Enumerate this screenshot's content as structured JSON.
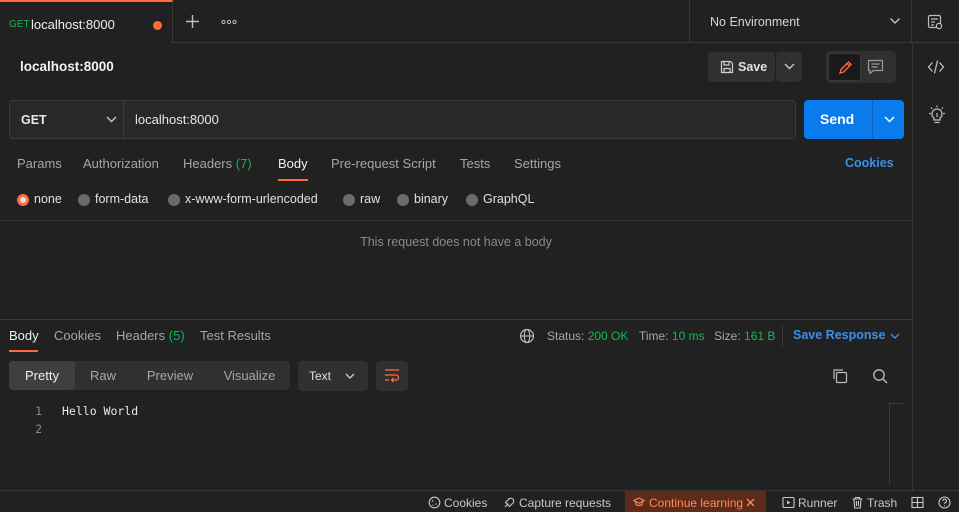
{
  "tab": {
    "method": "GET",
    "title": "localhost:8000"
  },
  "environment": {
    "label": "No Environment"
  },
  "request": {
    "name": "localhost:8000",
    "save_label": "Save",
    "method": "GET",
    "url": "localhost:8000",
    "send_label": "Send",
    "tabs": {
      "params": "Params",
      "authorization": "Authorization",
      "headers": "Headers",
      "headers_count": "(7)",
      "body": "Body",
      "prerequest": "Pre-request Script",
      "tests": "Tests",
      "settings": "Settings"
    },
    "cookies_link": "Cookies",
    "body_types": {
      "none": "none",
      "form_data": "form-data",
      "urlencoded": "x-www-form-urlencoded",
      "raw": "raw",
      "binary": "binary",
      "graphql": "GraphQL"
    },
    "selected_body_type": "none",
    "empty_body_message": "This request does not have a body"
  },
  "response": {
    "tabs": {
      "body": "Body",
      "cookies": "Cookies",
      "headers": "Headers",
      "headers_count": "(5)",
      "test_results": "Test Results"
    },
    "status_label": "Status:",
    "status_value": "200 OK",
    "time_label": "Time:",
    "time_value": "10 ms",
    "size_label": "Size:",
    "size_value": "161 B",
    "save_response": "Save Response",
    "views": {
      "pretty": "Pretty",
      "raw": "Raw",
      "preview": "Preview",
      "visualize": "Visualize"
    },
    "active_view": "Pretty",
    "format": "Text",
    "lines": [
      {
        "no": "1",
        "text": "Hello World"
      },
      {
        "no": "2",
        "text": ""
      }
    ]
  },
  "statusbar": {
    "cookies": "Cookies",
    "capture": "Capture requests",
    "continue_learning": "Continue learning",
    "runner": "Runner",
    "trash": "Trash"
  },
  "colors": {
    "accent": "#ff6c37",
    "send_blue": "#097bed",
    "link_blue": "#3d8fe8",
    "success_green": "#0cbb52",
    "background": "#212121"
  },
  "icons": [
    "plus-icon",
    "more-horizontal-icon",
    "chevron-down-icon",
    "environment-quicklook-icon",
    "save-icon",
    "pencil-icon",
    "comment-icon",
    "code-icon",
    "lightbulb-icon",
    "globe-icon",
    "wrap-lines-icon",
    "copy-icon",
    "search-icon",
    "cookie-icon",
    "capture-icon",
    "graduation-cap-icon",
    "close-icon",
    "runner-icon",
    "trash-icon",
    "two-pane-icon",
    "help-icon"
  ]
}
